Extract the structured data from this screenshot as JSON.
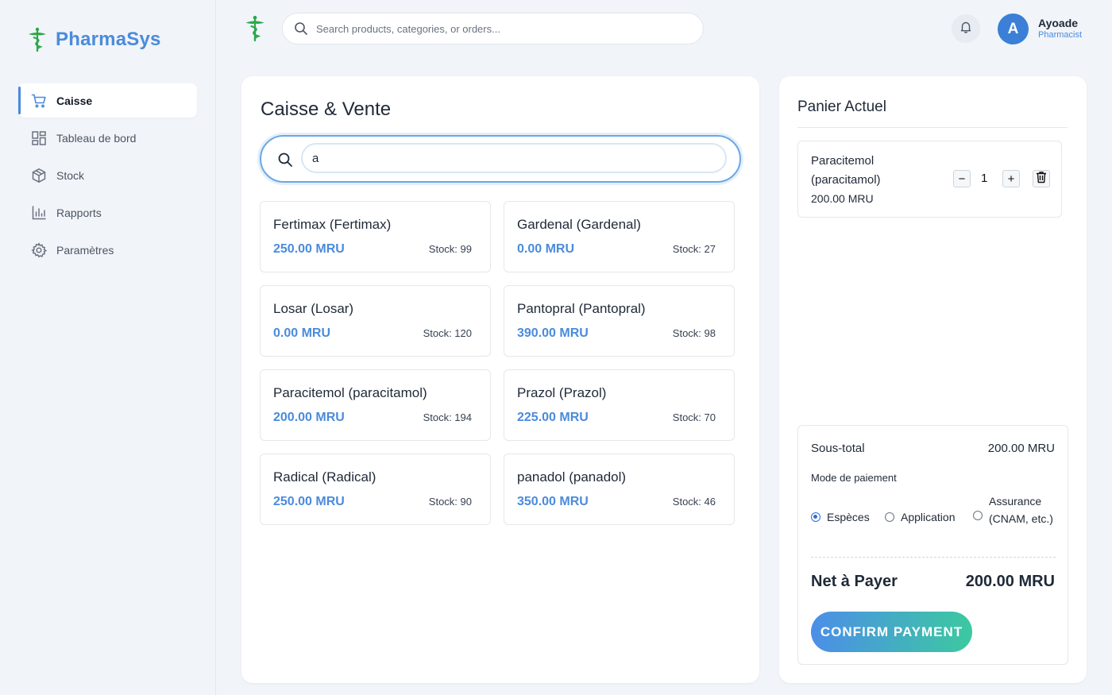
{
  "app": {
    "name": "PharmaSys"
  },
  "sidebar": {
    "items": [
      {
        "label": "Caisse",
        "icon": "cart-icon",
        "active": true
      },
      {
        "label": "Tableau de bord",
        "icon": "dashboard-icon"
      },
      {
        "label": "Stock",
        "icon": "box-icon"
      },
      {
        "label": "Rapports",
        "icon": "bar-chart-icon"
      },
      {
        "label": "Paramètres",
        "icon": "gear-icon"
      }
    ]
  },
  "header": {
    "search_placeholder": "Search products, categories, or orders...",
    "user": {
      "initial": "A",
      "name": "Ayoade",
      "role": "Pharmacist"
    }
  },
  "main": {
    "title": "Caisse & Vente",
    "search_value": "a",
    "products": [
      {
        "name": "Fertimax (Fertimax)",
        "price": "250.00 MRU",
        "stock": "Stock: 99"
      },
      {
        "name": "Gardenal (Gardenal)",
        "price": "0.00 MRU",
        "stock": "Stock: 27"
      },
      {
        "name": "Losar (Losar)",
        "price": "0.00 MRU",
        "stock": "Stock: 120"
      },
      {
        "name": "Pantopral (Pantopral)",
        "price": "390.00 MRU",
        "stock": "Stock: 98"
      },
      {
        "name": "Paracitemol (paracitamol)",
        "price": "200.00 MRU",
        "stock": "Stock: 194"
      },
      {
        "name": "Prazol (Prazol)",
        "price": "225.00 MRU",
        "stock": "Stock: 70"
      },
      {
        "name": "Radical (Radical)",
        "price": "250.00 MRU",
        "stock": "Stock: 90"
      },
      {
        "name": "panadol (panadol)",
        "price": "350.00 MRU",
        "stock": "Stock: 46"
      }
    ]
  },
  "cart": {
    "title": "Panier Actuel",
    "items": [
      {
        "name": "Paracitemol (paracitamol)",
        "price": "200.00 MRU",
        "qty": "1",
        "minus": "−",
        "plus": "+"
      }
    ],
    "subtotal_label": "Sous-total",
    "subtotal_value": "200.00 MRU",
    "payment_mode_label": "Mode de paiement",
    "payment_options": [
      "Espèces",
      "Application",
      "Assurance (CNAM, etc.)"
    ],
    "selected_payment": "Espèces",
    "net_label": "Net à Payer",
    "net_value": "200.00 MRU",
    "confirm_label": "CONFIRM PAYMENT"
  },
  "colors": {
    "accent": "#4a8bdc",
    "logo_green": "#2aa84a",
    "gradient_start": "#4c8ee8",
    "gradient_end": "#3cc9a0"
  }
}
